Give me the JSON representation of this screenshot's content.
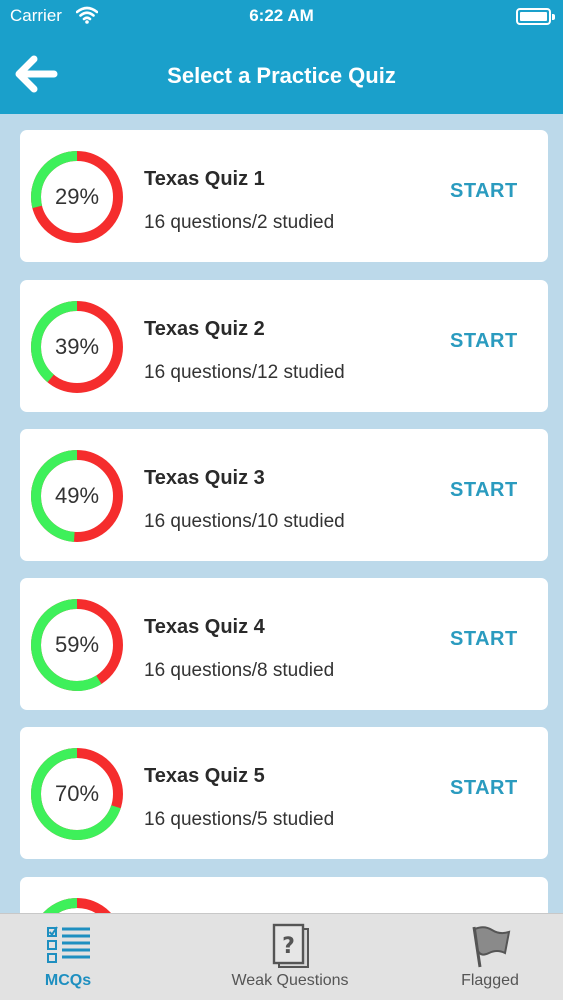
{
  "status_bar": {
    "carrier": "Carrier",
    "time": "6:22 AM"
  },
  "header": {
    "title": "Select a Practice Quiz",
    "back_icon": "arrow-left-icon"
  },
  "colors": {
    "accent": "#1aa0cb",
    "progress_remaining": "#f52d2d",
    "progress_done": "#3ef05a",
    "start_text": "#2a9bbf"
  },
  "quizzes": [
    {
      "name": "Texas Quiz 1",
      "detail": "16 questions/2 studied",
      "percent_label": "29%",
      "percent": 29,
      "action": "START"
    },
    {
      "name": "Texas Quiz 2",
      "detail": "16 questions/12 studied",
      "percent_label": "39%",
      "percent": 39,
      "action": "START"
    },
    {
      "name": "Texas Quiz 3",
      "detail": "16 questions/10 studied",
      "percent_label": "49%",
      "percent": 49,
      "action": "START"
    },
    {
      "name": "Texas Quiz 4",
      "detail": "16 questions/8 studied",
      "percent_label": "59%",
      "percent": 59,
      "action": "START"
    },
    {
      "name": "Texas Quiz 5",
      "detail": "16 questions/5 studied",
      "percent_label": "70%",
      "percent": 70,
      "action": "START"
    },
    {
      "name": "",
      "detail": "",
      "percent_label": "",
      "percent": 80,
      "action": ""
    }
  ],
  "tabs": [
    {
      "label": "MCQs",
      "icon": "checklist-icon",
      "active": true
    },
    {
      "label": "Weak Questions",
      "icon": "question-card-icon",
      "active": false
    },
    {
      "label": "Flagged",
      "icon": "flag-icon",
      "active": false
    }
  ]
}
